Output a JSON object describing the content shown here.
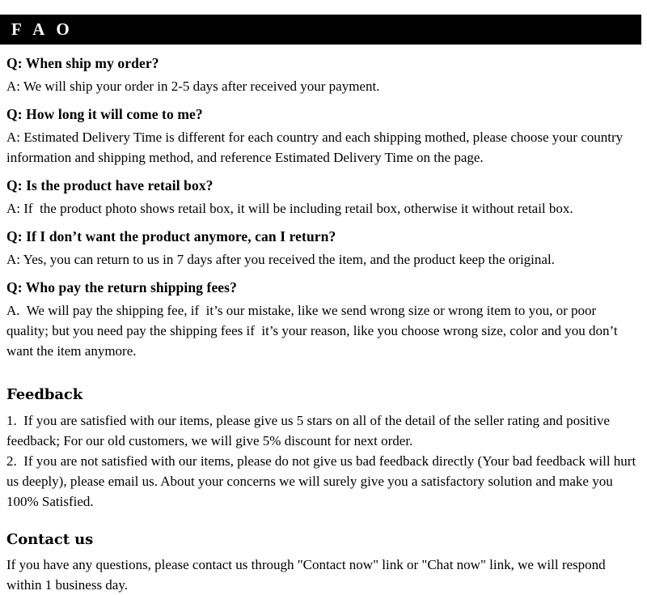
{
  "header": {
    "title": "F A O",
    "background_color": "#000000",
    "text_color": "#ffffff"
  },
  "faq": {
    "items": [
      {
        "question": "Q: When ship my order?",
        "answer": "A: We will ship your order in 2-5 days after received your payment."
      },
      {
        "question": "Q: How long it will come to me?",
        "answer": "A: Estimated Delivery Time is different for each country and each shipping mothed, please choose your country information and shipping method, and reference Estimated Delivery Time on the page."
      },
      {
        "question": "Q: Is the product have retail box?",
        "answer": "A: If  the product photo shows retail box, it will be including retail box, otherwise it without retail box."
      },
      {
        "question": "Q: If I don’t want the product anymore, can I return?",
        "answer": "A: Yes, you can return to us in 7 days after you received the item, and the product keep the original."
      },
      {
        "question": "Q: Who pay the return shipping fees?",
        "answer": "A.  We will pay the shipping fee, if  it’s our mistake, like we send wrong size or wrong item to you, or poor quality; but you need pay the shipping fees if  it’s your reason, like you choose wrong size, color and you don’t want the item anymore."
      }
    ]
  },
  "feedback": {
    "heading": "Feedback",
    "items": [
      "1.  If you are satisfied with our items, please give us 5 stars on all of the detail of the seller rating and positive feedback; For our old customers, we will give 5% discount for next order.",
      "2.  If you are not satisfied with our items, please do not give us bad feedback directly (Your bad feedback will hurt us deeply), please email us. About your concerns we will surely give you a satisfactory solution and make you 100% Satisfied."
    ]
  },
  "contact": {
    "heading": "Contact us",
    "body": "If you have any questions, please contact us through \"Contact now\" link or \"Chat now\" link, we will respond within 1 business day."
  }
}
